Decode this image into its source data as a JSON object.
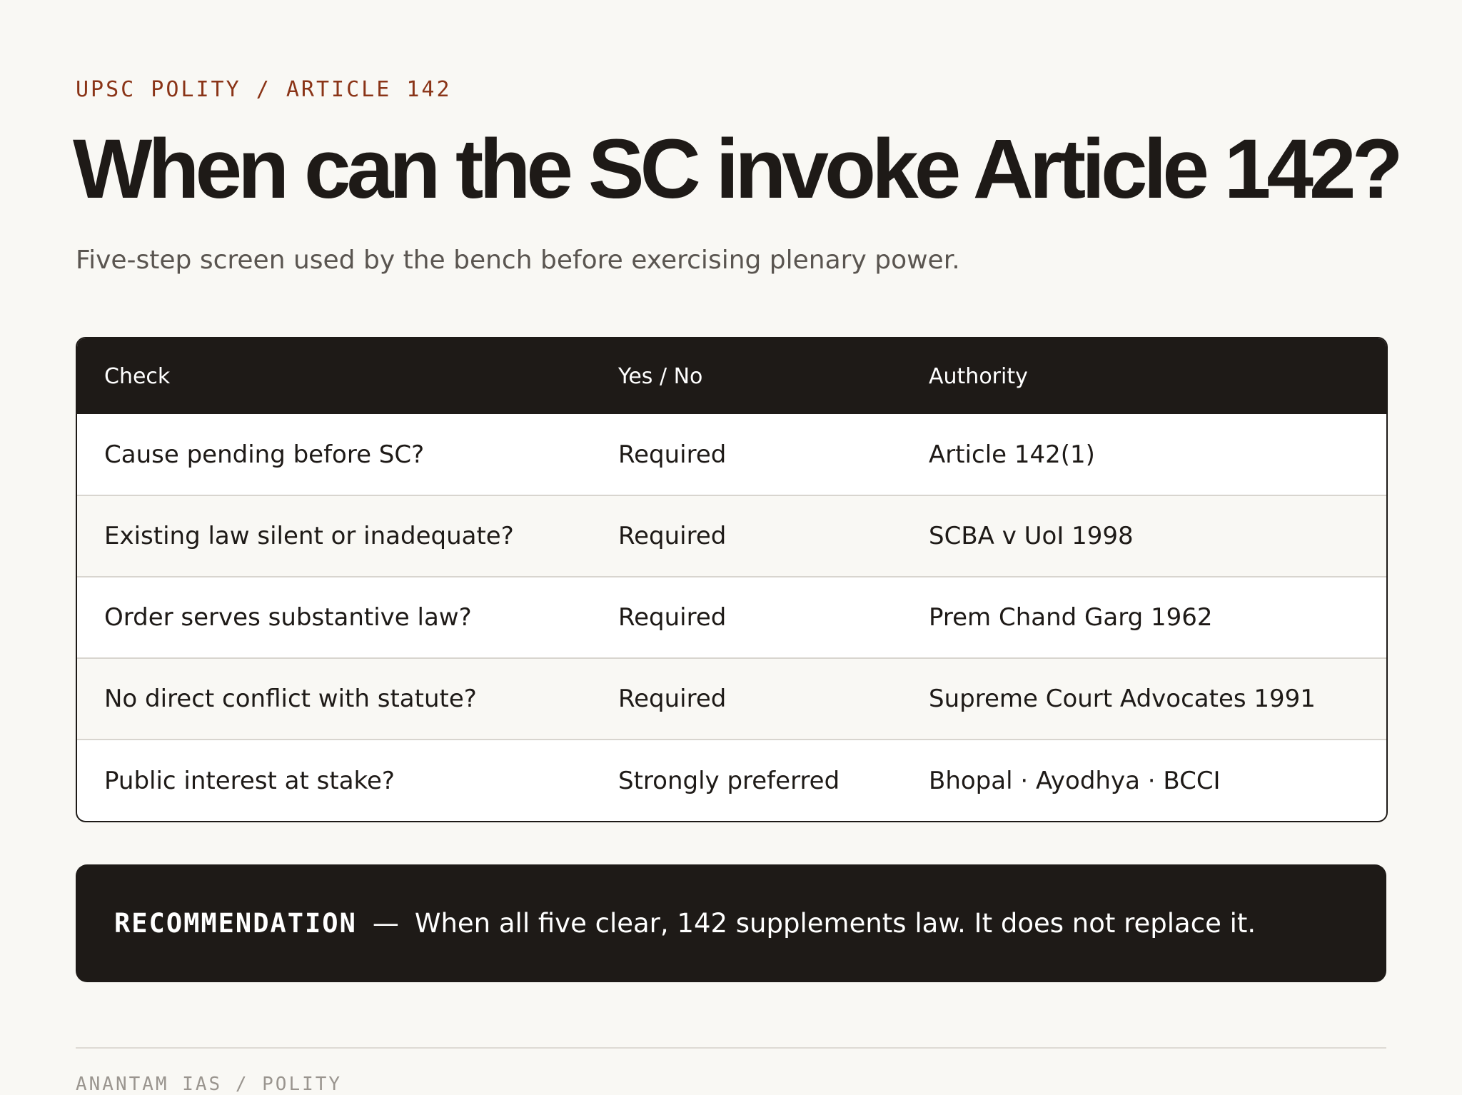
{
  "eyebrow": "UPSC POLITY / ARTICLE 142",
  "title": "When can the SC invoke Article 142?",
  "subtitle": "Five-step screen used by the bench before exercising plenary power.",
  "table": {
    "headers": [
      "Check",
      "Yes / No",
      "Authority"
    ],
    "rows": [
      [
        "Cause pending before SC?",
        "Required",
        "Article 142(1)"
      ],
      [
        "Existing law silent or inadequate?",
        "Required",
        "SCBA v UoI 1998"
      ],
      [
        "Order serves substantive law?",
        "Required",
        "Prem Chand Garg 1962"
      ],
      [
        "No direct conflict with statute?",
        "Required",
        "Supreme Court Advocates 1991"
      ],
      [
        "Public interest at stake?",
        "Strongly preferred",
        "Bhopal · Ayodhya · BCCI"
      ]
    ]
  },
  "callout": {
    "label": "RECOMMENDATION",
    "dash": "—",
    "text": "When all five clear, 142 supplements law. It does not replace it."
  },
  "footer": "ANANTAM IAS / POLITY",
  "colors": {
    "background": "#f9f8f4",
    "ink": "#1e1a17",
    "accent": "#8a3417",
    "muted": "#5a5550"
  }
}
